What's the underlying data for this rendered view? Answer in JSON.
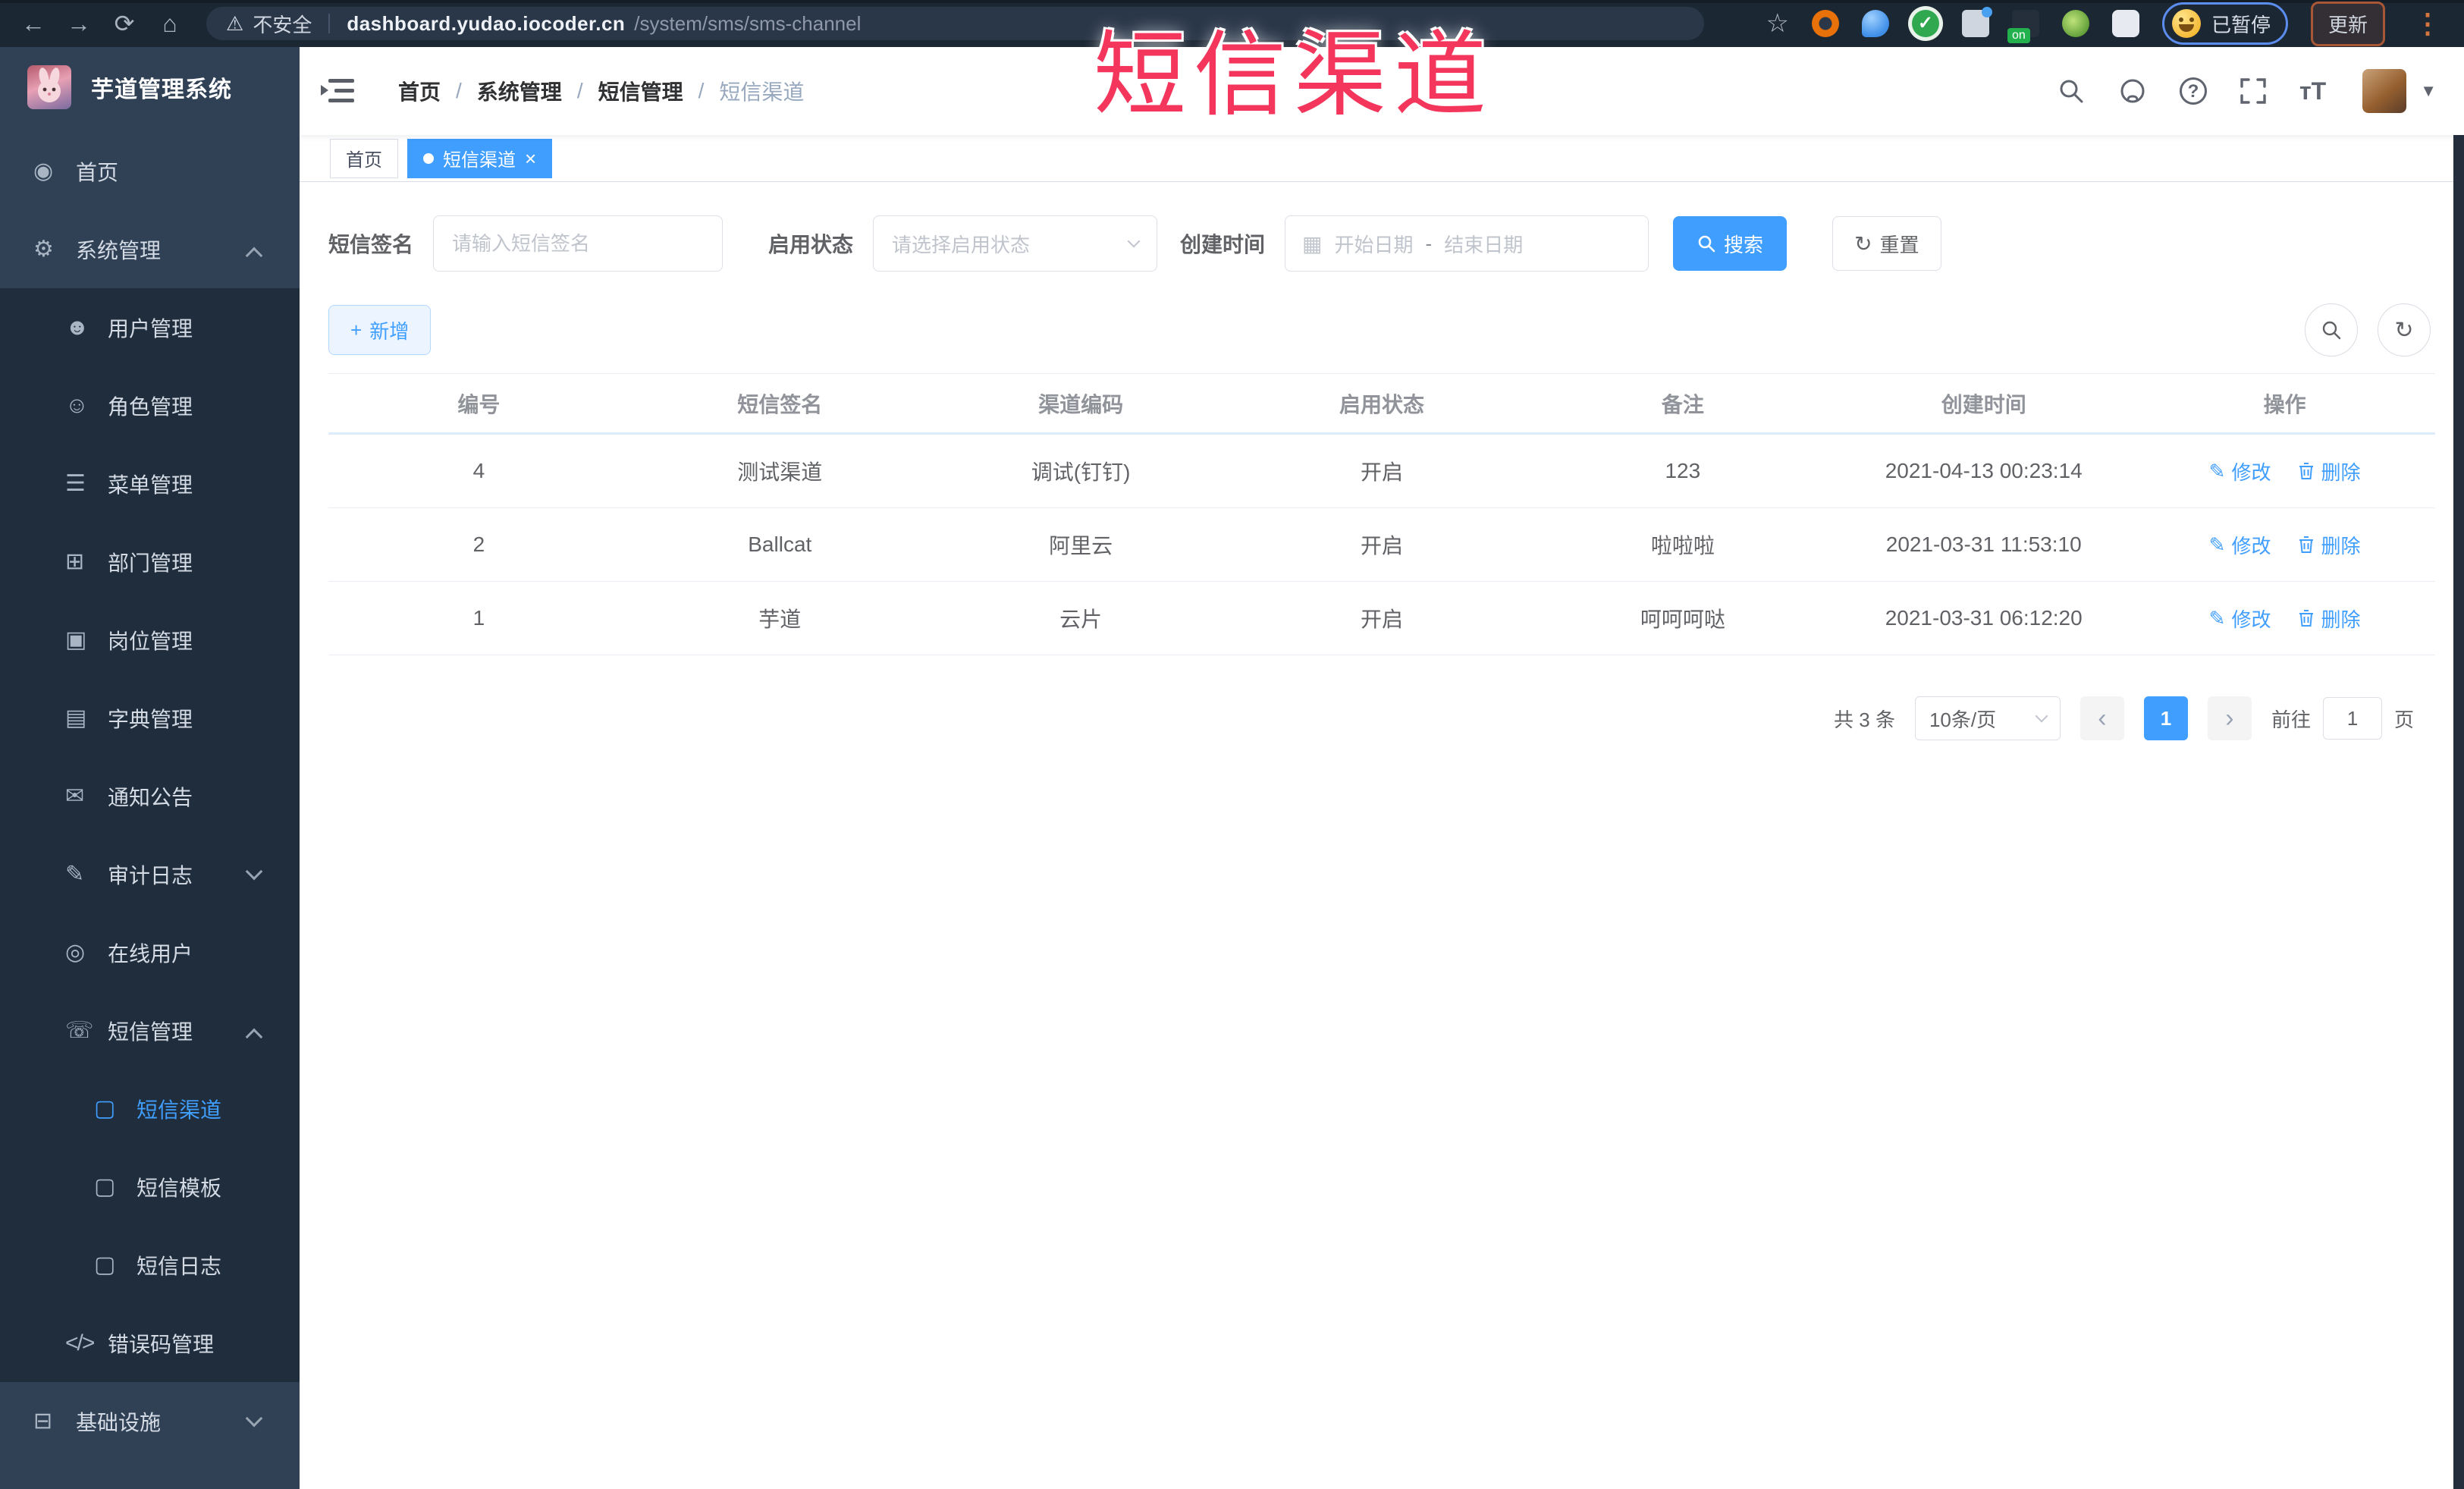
{
  "colors": {
    "primary": "#409EFF",
    "sidebar_bg": "#304156",
    "submenu_bg": "#1f2d3d",
    "browser_bar_bg": "#1c2734",
    "watermark_red": "#f5365c",
    "link_blue": "#409EFF"
  },
  "watermark": "短信渠道",
  "browser": {
    "back_glyph": "←",
    "forward_glyph": "→",
    "reload_glyph": "⟳",
    "home_glyph": "⌂",
    "warning_glyph": "⚠",
    "security_label": "不安全",
    "url_host": "dashboard.yudao.iocoder.cn",
    "url_path": "/system/sms/sms-channel",
    "star_glyph": "☆",
    "extension_check_glyph": "✓",
    "paused_label": "已暂停",
    "update_label": "更新",
    "menu_dots_glyph": "⋮"
  },
  "sidebar": {
    "app_title": "芋道管理系统",
    "items": [
      {
        "label": "首页",
        "icon": "dashboard-icon",
        "glyph": "◉"
      },
      {
        "label": "系统管理",
        "icon": "gear-icon",
        "glyph": "⚙"
      },
      {
        "label": "用户管理",
        "icon": "user-icon",
        "glyph": "☻"
      },
      {
        "label": "角色管理",
        "icon": "role-icon",
        "glyph": "☺"
      },
      {
        "label": "菜单管理",
        "icon": "menu-tree-icon",
        "glyph": "☰"
      },
      {
        "label": "部门管理",
        "icon": "department-icon",
        "glyph": "⊞"
      },
      {
        "label": "岗位管理",
        "icon": "post-icon",
        "glyph": "▣"
      },
      {
        "label": "字典管理",
        "icon": "dictionary-icon",
        "glyph": "▤"
      },
      {
        "label": "通知公告",
        "icon": "notice-icon",
        "glyph": "✉"
      },
      {
        "label": "审计日志",
        "icon": "audit-log-icon",
        "glyph": "✎"
      },
      {
        "label": "在线用户",
        "icon": "online-users-icon",
        "glyph": "◎"
      },
      {
        "label": "短信管理",
        "icon": "sms-icon",
        "glyph": "☏"
      },
      {
        "label": "短信渠道",
        "icon": "sms-channel-icon",
        "glyph": "▢"
      },
      {
        "label": "短信模板",
        "icon": "sms-template-icon",
        "glyph": "▢"
      },
      {
        "label": "短信日志",
        "icon": "sms-log-icon",
        "glyph": "▢"
      },
      {
        "label": "错误码管理",
        "icon": "error-code-icon",
        "glyph": "</>"
      },
      {
        "label": "基础设施",
        "icon": "infrastructure-icon",
        "glyph": "⊟"
      }
    ]
  },
  "navbar": {
    "breadcrumb": [
      "首页",
      "系统管理",
      "短信管理",
      "短信渠道"
    ],
    "separator": "/",
    "font_icon_text": "тT"
  },
  "tabs": [
    {
      "label": "首页"
    },
    {
      "label": "短信渠道",
      "close_glyph": "×"
    }
  ],
  "filters": {
    "signature_label": "短信签名",
    "signature_placeholder": "请输入短信签名",
    "status_label": "启用状态",
    "status_placeholder": "请选择启用状态",
    "date_label": "创建时间",
    "calendar_glyph": "▦",
    "date_start_placeholder": "开始日期",
    "date_separator": "-",
    "date_end_placeholder": "结束日期",
    "search_button": "搜索",
    "reset_button": "重置",
    "reset_glyph": "↻"
  },
  "toolbar": {
    "add_glyph": "+",
    "add_label": "新增",
    "refresh_glyph": "↻"
  },
  "table": {
    "columns": [
      "编号",
      "短信签名",
      "渠道编码",
      "启用状态",
      "备注",
      "创建时间",
      "操作"
    ],
    "edit_label": "修改",
    "edit_glyph": "✎",
    "delete_label": "删除",
    "rows": [
      {
        "id": "4",
        "signature": "测试渠道",
        "code": "调试(钉钉)",
        "status": "开启",
        "remark": "123",
        "created": "2021-04-13 00:23:14"
      },
      {
        "id": "2",
        "signature": "Ballcat",
        "code": "阿里云",
        "status": "开启",
        "remark": "啦啦啦",
        "created": "2021-03-31 11:53:10"
      },
      {
        "id": "1",
        "signature": "芋道",
        "code": "云片",
        "status": "开启",
        "remark": "呵呵呵哒",
        "created": "2021-03-31 06:12:20"
      }
    ]
  },
  "pagination": {
    "total": "共 3 条",
    "page_size": "10条/页",
    "prev_glyph": "‹",
    "current_page": "1",
    "next_glyph": "›",
    "goto_label": "前往",
    "goto_value": "1",
    "page_label": "页"
  }
}
